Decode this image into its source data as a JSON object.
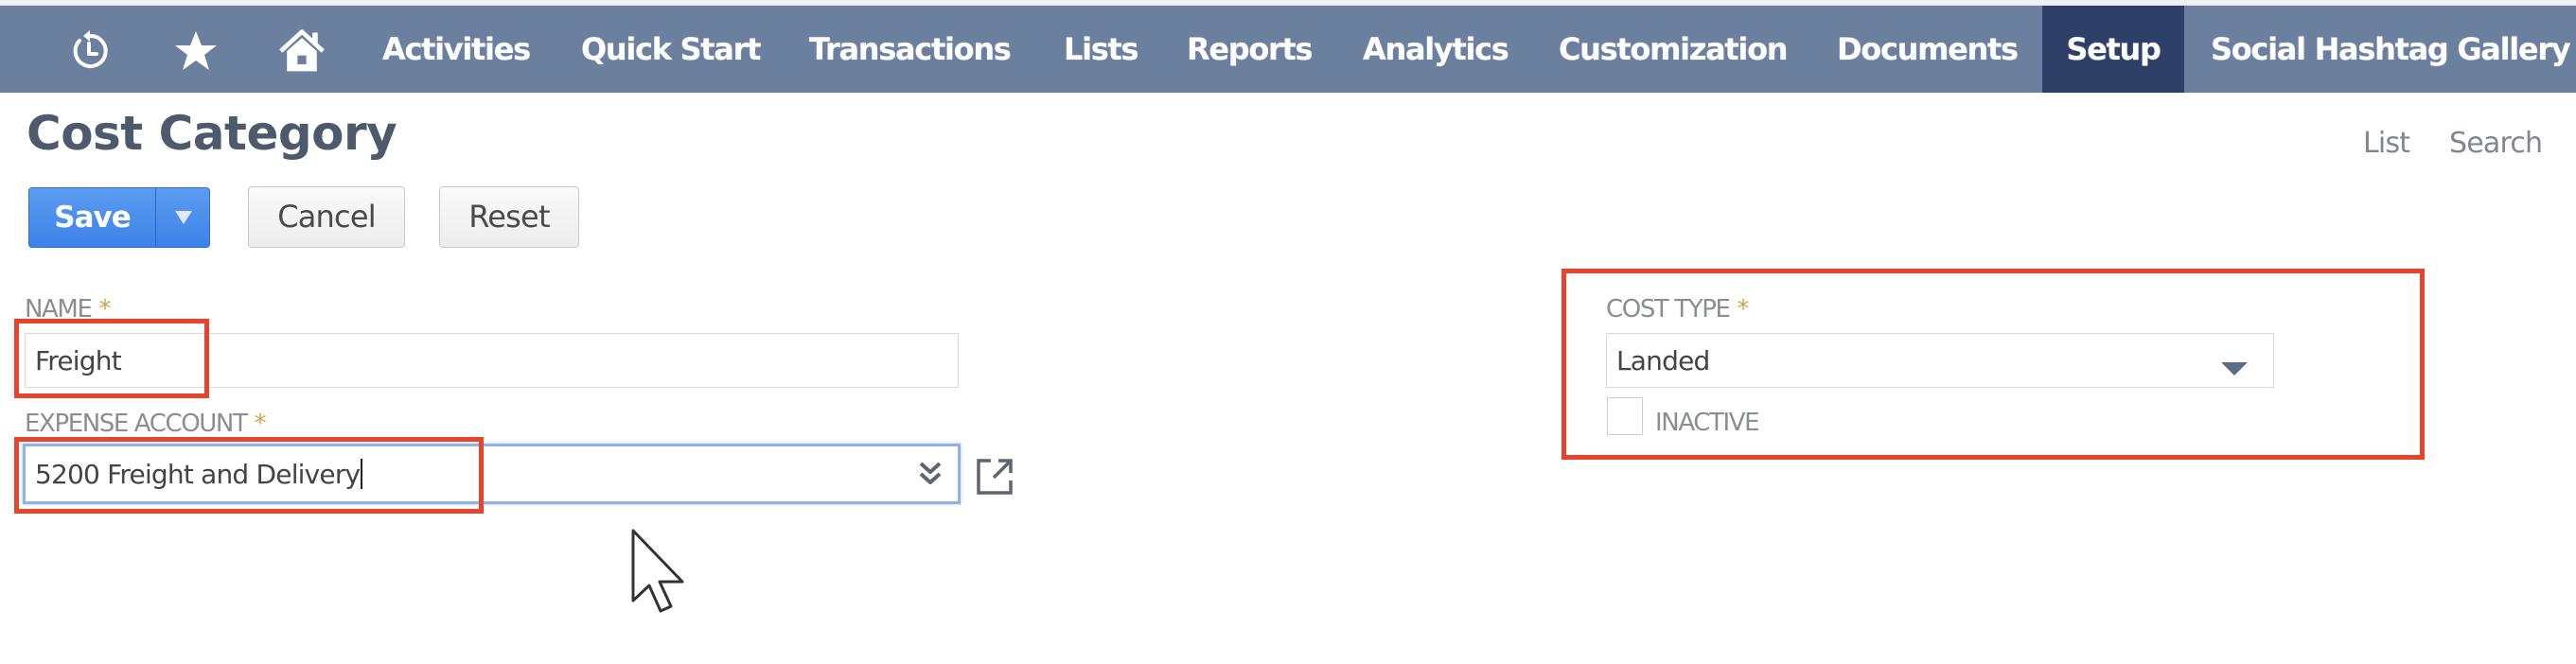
{
  "nav": {
    "icons": [
      "recent-records-icon",
      "favorites-star-icon",
      "home-icon"
    ],
    "items": [
      {
        "label": "Activities",
        "active": false
      },
      {
        "label": "Quick Start",
        "active": false
      },
      {
        "label": "Transactions",
        "active": false
      },
      {
        "label": "Lists",
        "active": false
      },
      {
        "label": "Reports",
        "active": false
      },
      {
        "label": "Analytics",
        "active": false
      },
      {
        "label": "Customization",
        "active": false
      },
      {
        "label": "Documents",
        "active": false
      },
      {
        "label": "Setup",
        "active": true
      },
      {
        "label": "Social Hashtag Gallery",
        "active": false
      }
    ]
  },
  "header": {
    "title": "Cost Category",
    "links": {
      "list": "List",
      "search": "Search"
    }
  },
  "toolbar": {
    "save_label": "Save",
    "save_menu_glyph": "▼",
    "cancel_label": "Cancel",
    "reset_label": "Reset"
  },
  "form": {
    "name": {
      "label": "NAME",
      "required_mark": "*",
      "value": "Freight"
    },
    "expense_account": {
      "label": "EXPENSE ACCOUNT",
      "required_mark": "*",
      "value": "5200 Freight and Delivery"
    },
    "cost_type": {
      "label": "COST TYPE",
      "required_mark": "*",
      "value": "Landed"
    },
    "inactive": {
      "label": "INACTIVE",
      "checked": false
    }
  },
  "colors": {
    "nav_bg": "#6b7f9f",
    "nav_active_bg": "#2e4068",
    "save_blue": "#4a8dec",
    "annotation_red": "#e8432b",
    "required_star": "#d3a24a"
  }
}
